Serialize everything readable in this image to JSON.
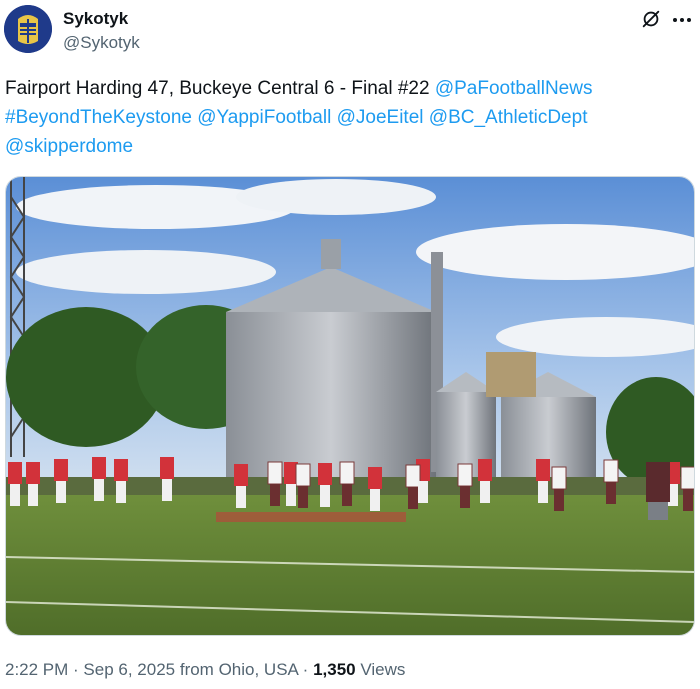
{
  "author": {
    "display_name": "Sykotyk",
    "handle": "@Sykotyk",
    "avatar_icon": "avatar-knight-helmet"
  },
  "tweet": {
    "parts": [
      {
        "kind": "text",
        "text": "Fairport Harding 47, Buckeye Central 6 - Final #22 "
      },
      {
        "kind": "mention",
        "text": "@PaFootballNews"
      },
      {
        "kind": "text",
        "text": " "
      },
      {
        "kind": "hashtag",
        "text": "#BeyondTheKeystone"
      },
      {
        "kind": "text",
        "text": " "
      },
      {
        "kind": "mention",
        "text": "@YappiFootball"
      },
      {
        "kind": "text",
        "text": " "
      },
      {
        "kind": "mention",
        "text": "@JoeEitel"
      },
      {
        "kind": "text",
        "text": " "
      },
      {
        "kind": "mention",
        "text": "@BC_AthleticDept"
      },
      {
        "kind": "text",
        "text": " "
      },
      {
        "kind": "mention",
        "text": "@skipperdome"
      }
    ]
  },
  "media": {
    "description_icon": "football-field-photo"
  },
  "meta": {
    "time": "2:22 PM",
    "separator": " · ",
    "date": "Sep 6, 2025",
    "location": " from Ohio, USA",
    "views_count": "1,350",
    "views_label": " Views"
  },
  "colors": {
    "link": "#1d9bf0",
    "text": "#0f1419",
    "muted": "#536471"
  }
}
